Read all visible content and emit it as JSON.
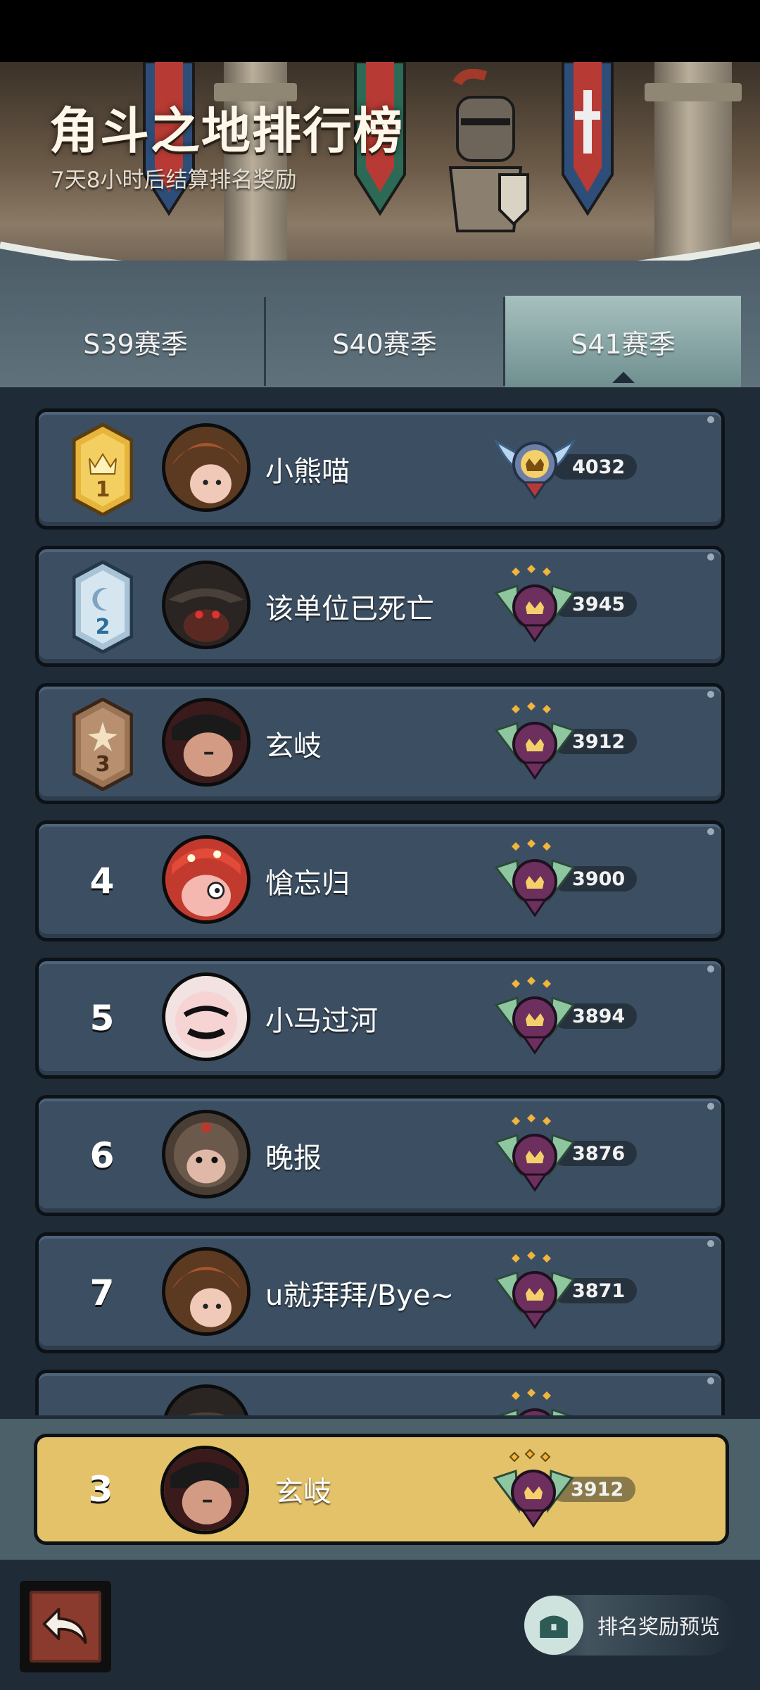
{
  "banner": {
    "title": "角斗之地排行榜",
    "subtitle": "7天8小时后结算排名奖励"
  },
  "tabs": [
    {
      "label": "S39赛季",
      "active": false
    },
    {
      "label": "S40赛季",
      "active": false
    },
    {
      "label": "S41赛季",
      "active": true
    }
  ],
  "leaderboard": [
    {
      "rank": "1",
      "name": "小熊喵",
      "score": "4032"
    },
    {
      "rank": "2",
      "name": "该单位已死亡",
      "score": "3945"
    },
    {
      "rank": "3",
      "name": "玄岐",
      "score": "3912"
    },
    {
      "rank": "4",
      "name": "愴忘归",
      "score": "3900"
    },
    {
      "rank": "5",
      "name": "小马过河",
      "score": "3894"
    },
    {
      "rank": "6",
      "name": "晚报",
      "score": "3876"
    },
    {
      "rank": "7",
      "name": "u就拜拜/Bye~",
      "score": "3871"
    }
  ],
  "my_rank": {
    "rank": "3",
    "name": "玄岐",
    "score": "3912"
  },
  "footer": {
    "reward_preview_label": "排名奖励预览"
  },
  "colors": {
    "row_bg": "#3c4f62",
    "my_row_bg": "#e3c26a",
    "tab_active": "#a6c0bf",
    "gold": "#e7b53c",
    "silver": "#a8c3d6",
    "bronze": "#9a7455"
  },
  "icons": {
    "back": "back-arrow-icon",
    "reward": "treasure-chest-icon",
    "medal_top": "winged-crown-medal-icon",
    "medal": "crown-medal-icon"
  }
}
